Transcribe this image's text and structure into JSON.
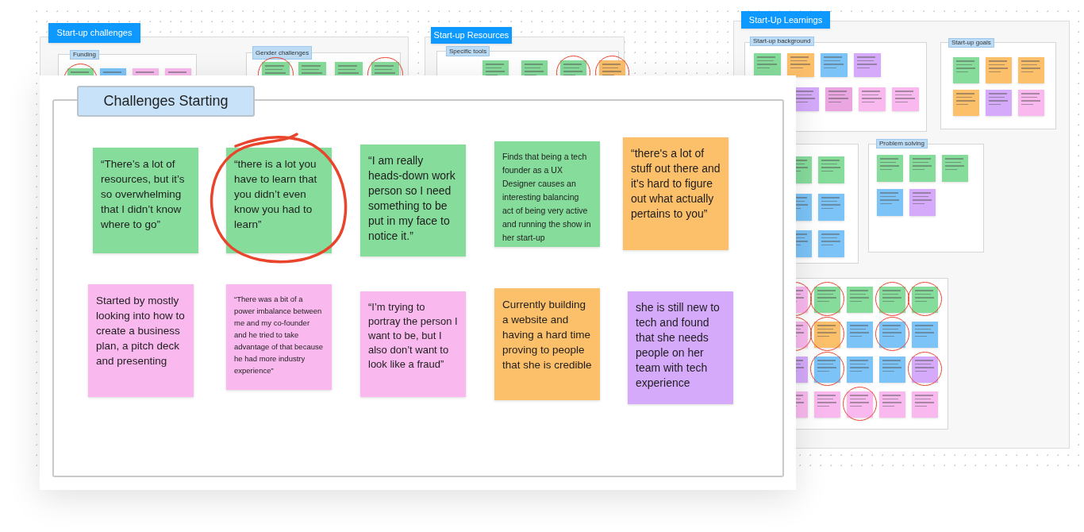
{
  "boards": [
    {
      "title": "Start-up challenges",
      "groups": [
        {
          "label": "Funding",
          "notes": [
            {
              "color": "#86dc9b",
              "circled": true
            },
            {
              "color": "#7cc4f8",
              "circled": false
            },
            {
              "color": "#f9b9ee",
              "circled": false
            },
            {
              "color": "#f9b9ee",
              "circled": false
            }
          ]
        },
        {
          "label": "Gender challenges",
          "notes": [
            {
              "color": "#86dc9b",
              "circled": true
            },
            {
              "color": "#86dc9b",
              "circled": false
            },
            {
              "color": "#86dc9b",
              "circled": false
            },
            {
              "color": "#86dc9b",
              "circled": true
            }
          ]
        }
      ]
    },
    {
      "title": "Start-up Resources",
      "groups": [
        {
          "label": "Specific tools",
          "notes": [
            {
              "color": "#86dc9b",
              "circled": false
            },
            {
              "color": "#86dc9b",
              "circled": false
            },
            {
              "color": "#86dc9b",
              "circled": true
            },
            {
              "color": "#fcbf6a",
              "circled": true
            }
          ]
        }
      ]
    },
    {
      "title": "Start-Up Learnings",
      "groups": [
        {
          "label": "Start-up background",
          "notes": [
            {
              "color": "#86dc9b",
              "circled": false
            },
            {
              "color": "#fcbf6a",
              "circled": false
            },
            {
              "color": "#7cc4f8",
              "circled": false
            },
            {
              "color": "#d5aafb",
              "circled": false
            },
            {
              "color": "#d5aafb",
              "circled": false
            },
            {
              "color": "#eaa6e0",
              "circled": false
            },
            {
              "color": "#f9b9ee",
              "circled": false
            },
            {
              "color": "#f9b9ee",
              "circled": false
            }
          ]
        },
        {
          "label": "Start-up goals",
          "notes": [
            {
              "color": "#86dc9b",
              "circled": false
            },
            {
              "color": "#fcbf6a",
              "circled": false
            },
            {
              "color": "#fcbf6a",
              "circled": false
            },
            {
              "color": "#fcbf6a",
              "circled": false
            },
            {
              "color": "#d5aafb",
              "circled": false
            },
            {
              "color": "#f9b9ee",
              "circled": false
            }
          ]
        },
        {
          "notes": [
            {
              "color": "#86dc9b",
              "circled": false
            },
            {
              "color": "#86dc9b",
              "circled": false
            },
            {
              "color": "#7cc4f8",
              "circled": false
            },
            {
              "color": "#7cc4f8",
              "circled": false
            },
            {
              "color": "#7cc4f8",
              "circled": false
            },
            {
              "color": "#7cc4f8",
              "circled": false
            }
          ]
        },
        {
          "label": "Problem solving",
          "notes": [
            {
              "color": "#86dc9b",
              "circled": false
            },
            {
              "color": "#86dc9b",
              "circled": false
            },
            {
              "color": "#86dc9b",
              "circled": false
            },
            {
              "color": "#7cc4f8",
              "circled": false
            },
            {
              "color": "#d5aafb",
              "circled": false
            }
          ]
        },
        {
          "notes": [
            {
              "color": "#f9b9ee",
              "circled": true
            },
            {
              "color": "#86dc9b",
              "circled": true
            },
            {
              "color": "#86dc9b",
              "circled": false
            },
            {
              "color": "#86dc9b",
              "circled": true
            },
            {
              "color": "#86dc9b",
              "circled": true
            },
            {
              "color": "#f9b9ee",
              "circled": true
            },
            {
              "color": "#fcbf6a",
              "circled": true
            },
            {
              "color": "#7cc4f8",
              "circled": false
            },
            {
              "color": "#7cc4f8",
              "circled": true
            },
            {
              "color": "#7cc4f8",
              "circled": false
            },
            {
              "color": "#d5aafb",
              "circled": false
            },
            {
              "color": "#7cc4f8",
              "circled": true
            },
            {
              "color": "#7cc4f8",
              "circled": false
            },
            {
              "color": "#7cc4f8",
              "circled": false
            },
            {
              "color": "#d5aafb",
              "circled": true
            },
            {
              "color": "#f9b9ee",
              "circled": false
            },
            {
              "color": "#f9b9ee",
              "circled": false
            },
            {
              "color": "#f9b9ee",
              "circled": true
            },
            {
              "color": "#f9b9ee",
              "circled": false
            },
            {
              "color": "#f9b9ee",
              "circled": false
            }
          ]
        }
      ]
    }
  ],
  "frame": {
    "title": "Challenges Starting",
    "notes": [
      {
        "text": "“There’s a lot of resources, but it’s so overwhelming that I didn’t know where to go”",
        "color": "#86dc9b",
        "circled": false
      },
      {
        "text": "“there is a lot you have to learn that you didn’t even know you had to learn”",
        "color": "#86dc9b",
        "circled": true
      },
      {
        "text": "“I am really heads-down work person so I need something to be put in my face to notice it.”",
        "color": "#86dc9b",
        "circled": false
      },
      {
        "text": "Finds that being a tech founder as a UX Designer causes an interesting balancing act of being very active and running the show in her start-up",
        "color": "#86dc9b",
        "circled": false
      },
      {
        "text": "“there's a lot of stuff out there and it's hard to figure out what actually pertains to you”",
        "color": "#fcbf6a",
        "circled": false
      },
      {
        "text": "Started by mostly looking into how to create a business plan, a pitch deck  and presenting",
        "color": "#f9b9ee",
        "circled": false
      },
      {
        "text": "“There was a bit of a power imbalance between me and my co-founder and he tried to take advantage of that because he had more industry experience”",
        "color": "#f9b9ee",
        "circled": false
      },
      {
        "text": "“I’m trying to portray the person I want to be, but I also don’t want to look like a fraud”",
        "color": "#f9b9ee",
        "circled": false
      },
      {
        "text": "Currently building a website and having a hard time proving to people that she is credible",
        "color": "#fcbf6a",
        "circled": false
      },
      {
        "text": "she is still new to tech and found that she needs people on her team with tech experience",
        "color": "#d5aafb",
        "circled": false
      }
    ]
  }
}
